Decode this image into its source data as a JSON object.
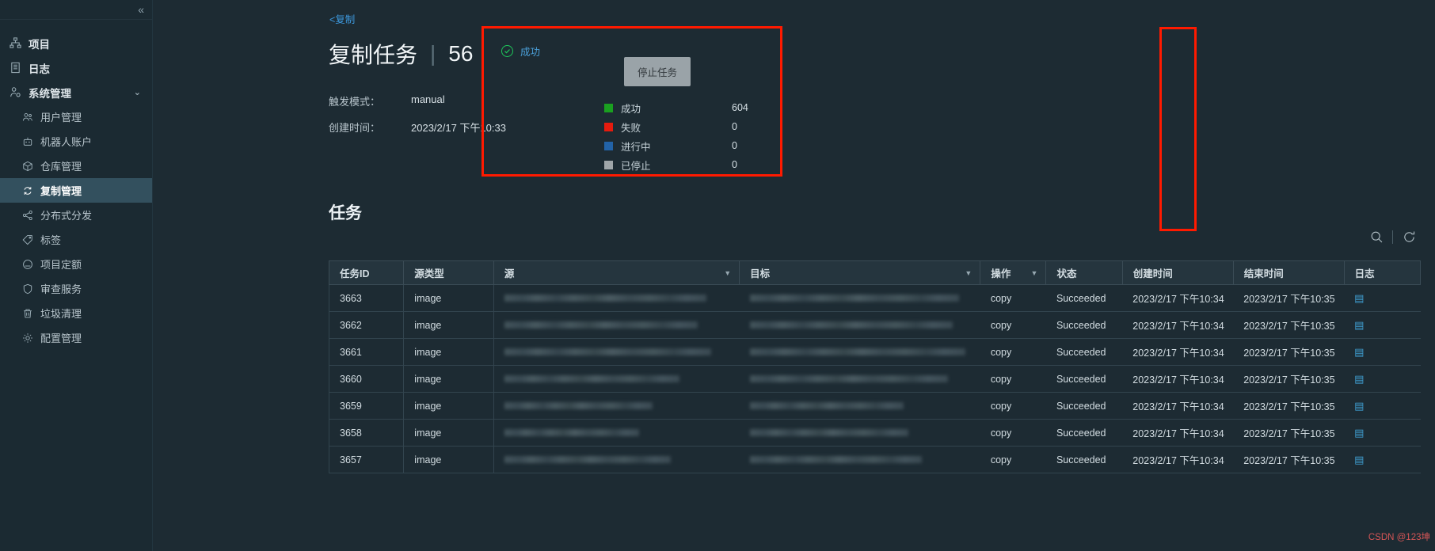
{
  "sidebar": {
    "collapse_icon": "«",
    "items": [
      {
        "label": "项目",
        "icon": "sitemap-icon",
        "level": "top",
        "active": false
      },
      {
        "label": "日志",
        "icon": "log-book-icon",
        "level": "top",
        "active": false
      },
      {
        "label": "系统管理",
        "icon": "user-gear-icon",
        "level": "top",
        "active": false,
        "expanded": true,
        "chevron": "⌄"
      },
      {
        "label": "用户管理",
        "icon": "users-icon",
        "level": "sub",
        "active": false
      },
      {
        "label": "机器人账户",
        "icon": "robot-icon",
        "level": "sub",
        "active": false
      },
      {
        "label": "仓库管理",
        "icon": "cube-icon",
        "level": "sub",
        "active": false
      },
      {
        "label": "复制管理",
        "icon": "replication-icon",
        "level": "sub",
        "active": true
      },
      {
        "label": "分布式分发",
        "icon": "share-nodes-icon",
        "level": "sub",
        "active": false
      },
      {
        "label": "标签",
        "icon": "tag-icon",
        "level": "sub",
        "active": false
      },
      {
        "label": "项目定额",
        "icon": "quota-circle-icon",
        "level": "sub",
        "active": false
      },
      {
        "label": "审查服务",
        "icon": "shield-icon",
        "level": "sub",
        "active": false
      },
      {
        "label": "垃圾清理",
        "icon": "trash-icon",
        "level": "sub",
        "active": false
      },
      {
        "label": "配置管理",
        "icon": "gear-icon",
        "level": "sub",
        "active": false
      }
    ]
  },
  "header": {
    "breadcrumb": "<复制",
    "title": "复制任务",
    "divider": "|",
    "job_id": "56"
  },
  "meta": {
    "trigger_label": "触发模式：",
    "trigger_value": "manual",
    "created_label": "创建时间：",
    "created_value": "2023/2/17 下午10:33"
  },
  "status_panel": {
    "state_label": "成功",
    "state_icon": "check-circle-icon",
    "stop_button": "停止任务",
    "legend": [
      {
        "name": "成功",
        "value": "604",
        "color": "#1aa020"
      },
      {
        "name": "失败",
        "value": "0",
        "color": "#e51b0e"
      },
      {
        "name": "进行中",
        "value": "0",
        "color": "#2263a8"
      },
      {
        "name": "已停止",
        "value": "0",
        "color": "#9fa6a9"
      }
    ]
  },
  "tasks_section": {
    "title": "任务",
    "search_icon": "search-icon",
    "refresh_icon": "refresh-icon",
    "columns": [
      {
        "label": "任务ID",
        "filter": false
      },
      {
        "label": "源类型",
        "filter": false
      },
      {
        "label": "源",
        "filter": true
      },
      {
        "label": "目标",
        "filter": true
      },
      {
        "label": "操作",
        "filter": true
      },
      {
        "label": "状态",
        "filter": false
      },
      {
        "label": "创建时间",
        "filter": false
      },
      {
        "label": "结束时间",
        "filter": false
      },
      {
        "label": "日志",
        "filter": false
      }
    ],
    "rows": [
      {
        "id": "3663",
        "type": "image",
        "source": "",
        "target": "",
        "op": "copy",
        "status": "Succeeded",
        "created": "2023/2/17 下午10:34",
        "ended": "2023/2/17 下午10:35",
        "log": "log-icon"
      },
      {
        "id": "3662",
        "type": "image",
        "source": "",
        "target": "",
        "op": "copy",
        "status": "Succeeded",
        "created": "2023/2/17 下午10:34",
        "ended": "2023/2/17 下午10:35",
        "log": "log-icon"
      },
      {
        "id": "3661",
        "type": "image",
        "source": "",
        "target": "",
        "op": "copy",
        "status": "Succeeded",
        "created": "2023/2/17 下午10:34",
        "ended": "2023/2/17 下午10:35",
        "log": "log-icon"
      },
      {
        "id": "3660",
        "type": "image",
        "source": "",
        "target": "",
        "op": "copy",
        "status": "Succeeded",
        "created": "2023/2/17 下午10:34",
        "ended": "2023/2/17 下午10:35",
        "log": "log-icon"
      },
      {
        "id": "3659",
        "type": "image",
        "source": "",
        "target": "",
        "op": "copy",
        "status": "Succeeded",
        "created": "2023/2/17 下午10:34",
        "ended": "2023/2/17 下午10:35",
        "log": "log-icon"
      },
      {
        "id": "3658",
        "type": "image",
        "source": "",
        "target": "",
        "op": "copy",
        "status": "Succeeded",
        "created": "2023/2/17 下午10:34",
        "ended": "2023/2/17 下午10:35",
        "log": "log-icon"
      },
      {
        "id": "3657",
        "type": "image",
        "source": "",
        "target": "",
        "op": "copy",
        "status": "Succeeded",
        "created": "2023/2/17 下午10:34",
        "ended": "2023/2/17 下午10:35",
        "log": "log-icon"
      }
    ]
  },
  "watermark": "CSDN @123坤",
  "colors": {
    "accent_link": "#3d9ae0",
    "highlight_box": "#ff1a00",
    "sidebar_active": "#33505e",
    "background": "#1d2b33"
  }
}
